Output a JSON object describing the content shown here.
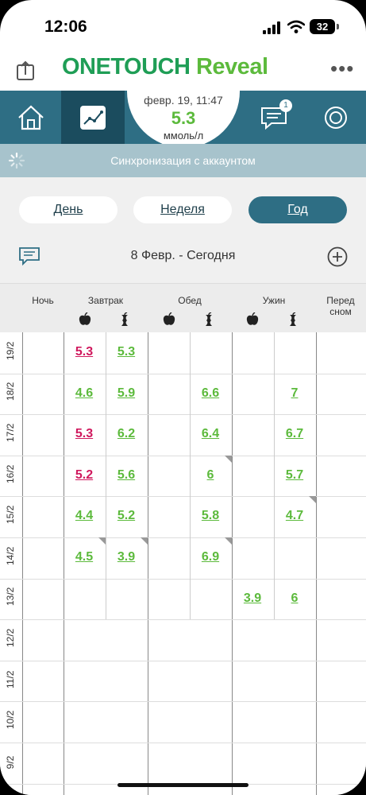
{
  "status_bar": {
    "time": "12:06",
    "battery": "32"
  },
  "header": {
    "brand_one": "ONETOUCH",
    "brand_two": "Reveal"
  },
  "nav": {
    "last_reading": {
      "datetime": "февр. 19, 11:47",
      "value": "5.3",
      "unit": "ммоль/л"
    },
    "messages_badge": "1"
  },
  "sync": {
    "text": "Синхронизация с аккаунтом"
  },
  "tabs": [
    {
      "label": "День"
    },
    {
      "label": "Неделя"
    },
    {
      "label": "Год"
    }
  ],
  "range": {
    "label": "8 Февр. - Сегодня"
  },
  "columns": [
    "Ночь",
    "Завтрак",
    "Обед",
    "Ужин",
    "Перед сном"
  ],
  "colors": {
    "in_range": "#5cba3c",
    "low": "#d0195e",
    "nav": "#2e6e84"
  },
  "rows": [
    {
      "date": "19/2",
      "cells": [
        {
          "col": 1,
          "v": "5.3",
          "c": "pink"
        },
        {
          "col": 2,
          "v": "5.3",
          "c": "green"
        }
      ]
    },
    {
      "date": "18/2",
      "cells": [
        {
          "col": 1,
          "v": "4.6",
          "c": "green"
        },
        {
          "col": 2,
          "v": "5.9",
          "c": "green"
        },
        {
          "col": 4,
          "v": "6.6",
          "c": "green"
        },
        {
          "col": 6,
          "v": "7",
          "c": "green"
        }
      ]
    },
    {
      "date": "17/2",
      "cells": [
        {
          "col": 1,
          "v": "5.3",
          "c": "pink"
        },
        {
          "col": 2,
          "v": "6.2",
          "c": "green"
        },
        {
          "col": 4,
          "v": "6.4",
          "c": "green"
        },
        {
          "col": 6,
          "v": "6.7",
          "c": "green"
        }
      ]
    },
    {
      "date": "16/2",
      "cells": [
        {
          "col": 1,
          "v": "5.2",
          "c": "pink"
        },
        {
          "col": 2,
          "v": "5.6",
          "c": "green"
        },
        {
          "col": 4,
          "v": "6",
          "c": "green"
        },
        {
          "col": 6,
          "v": "5.7",
          "c": "green"
        }
      ]
    },
    {
      "date": "15/2",
      "cells": [
        {
          "col": 1,
          "v": "4.4",
          "c": "green"
        },
        {
          "col": 2,
          "v": "5.2",
          "c": "green"
        },
        {
          "col": 4,
          "v": "5.8",
          "c": "green"
        },
        {
          "col": 6,
          "v": "4.7",
          "c": "green"
        }
      ]
    },
    {
      "date": "14/2",
      "cells": [
        {
          "col": 1,
          "v": "4.5",
          "c": "green"
        },
        {
          "col": 2,
          "v": "3.9",
          "c": "green"
        },
        {
          "col": 4,
          "v": "6.9",
          "c": "green"
        }
      ]
    },
    {
      "date": "13/2",
      "cells": [
        {
          "col": 5,
          "v": "3.9",
          "c": "green"
        },
        {
          "col": 6,
          "v": "6",
          "c": "green"
        }
      ]
    },
    {
      "date": "12/2",
      "cells": []
    },
    {
      "date": "11/2",
      "cells": []
    },
    {
      "date": "10/2",
      "cells": []
    },
    {
      "date": "9/2",
      "cells": []
    }
  ]
}
